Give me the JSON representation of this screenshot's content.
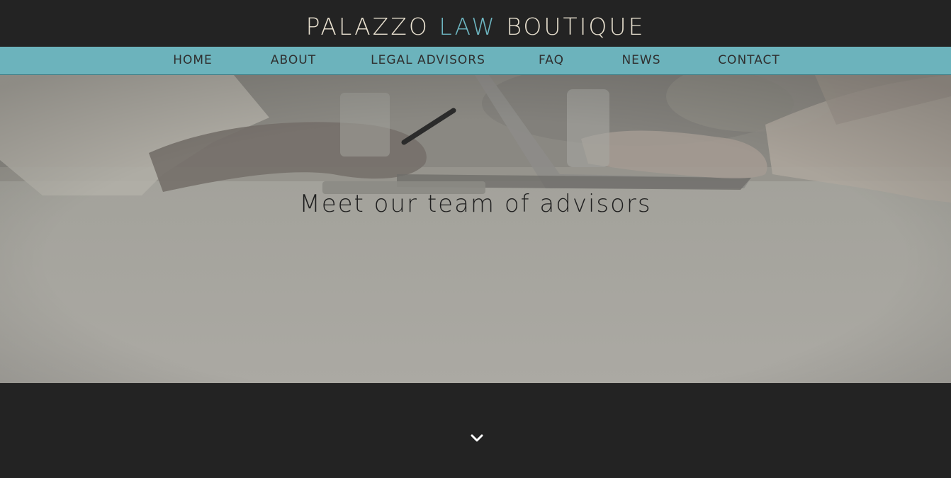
{
  "brand": {
    "word1": "PALAZZO",
    "word2": "LAW",
    "word3": "BOUTIQUE"
  },
  "nav": {
    "items": [
      {
        "label": "HOME"
      },
      {
        "label": "ABOUT"
      },
      {
        "label": "LEGAL ADVISORS"
      },
      {
        "label": "FAQ"
      },
      {
        "label": "NEWS"
      },
      {
        "label": "CONTACT"
      }
    ]
  },
  "hero": {
    "title": "Meet our team of advisors"
  },
  "icons": {
    "scroll_down": "chevron-down-icon"
  },
  "colors": {
    "header_bg": "#232323",
    "nav_bg": "#6cb3bc",
    "brand_text": "#e8e0cf",
    "brand_accent": "#6db5c0",
    "nav_text": "#2f2f2f",
    "hero_text": "#1f1f1f"
  }
}
